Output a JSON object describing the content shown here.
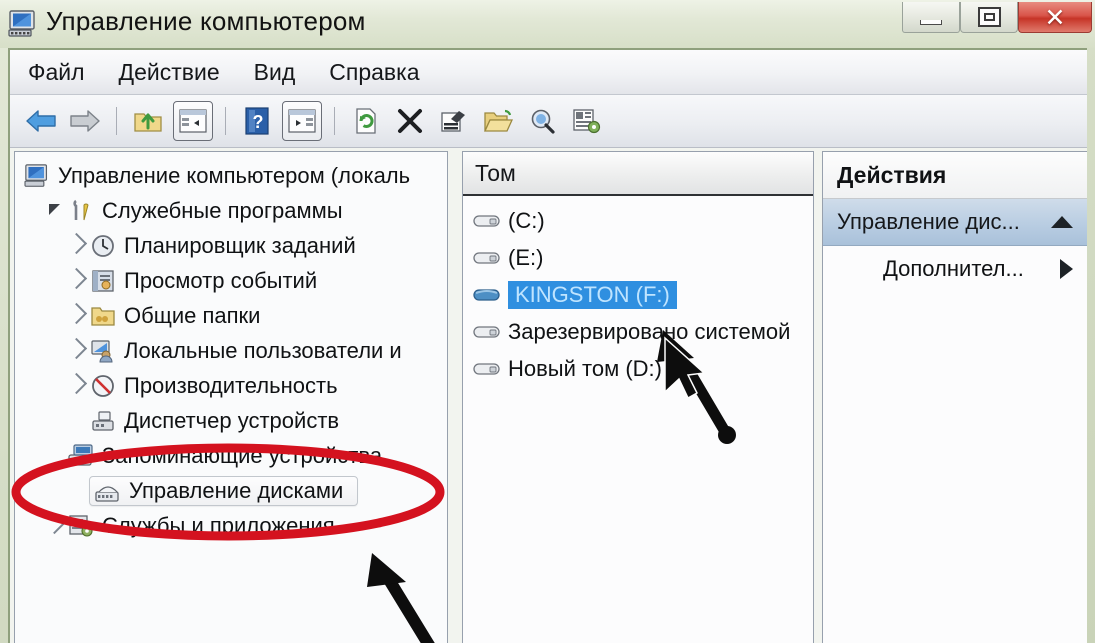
{
  "window": {
    "title": "Управление компьютером",
    "icon": "computer-icon",
    "controls": {
      "minimize": "—",
      "maximize": "❐",
      "close": "✕"
    }
  },
  "menu": {
    "items": [
      "Файл",
      "Действие",
      "Вид",
      "Справка"
    ]
  },
  "toolbar": {
    "items": [
      "back-arrow-icon",
      "forward-arrow-icon",
      "up-folder-icon",
      "show-tree-pane-icon",
      "help-icon",
      "show-action-pane-icon",
      "refresh-icon",
      "delete-icon",
      "properties-icon",
      "open-folder-icon",
      "search-icon",
      "settings-icon"
    ]
  },
  "tree": {
    "nodes": [
      {
        "label": "Управление компьютером (локаль",
        "icon": "computer-icon",
        "indent": 0,
        "twisty": "none",
        "selected": false
      },
      {
        "label": "Служебные программы",
        "icon": "tools-icon",
        "indent": 1,
        "twisty": "expanded",
        "selected": false
      },
      {
        "label": "Планировщик заданий",
        "icon": "clock-icon",
        "indent": 2,
        "twisty": "collapsed",
        "selected": false
      },
      {
        "label": "Просмотр событий",
        "icon": "event-log-icon",
        "indent": 2,
        "twisty": "collapsed",
        "selected": false
      },
      {
        "label": "Общие папки",
        "icon": "shared-folder-icon",
        "indent": 2,
        "twisty": "collapsed",
        "selected": false
      },
      {
        "label": "Локальные пользователи и",
        "icon": "users-icon",
        "indent": 2,
        "twisty": "collapsed",
        "selected": false
      },
      {
        "label": "Производительность",
        "icon": "performance-icon",
        "indent": 2,
        "twisty": "collapsed",
        "selected": false
      },
      {
        "label": "Диспетчер устройств",
        "icon": "device-manager-icon",
        "indent": 2,
        "twisty": "none",
        "selected": false
      },
      {
        "label": "Запоминающие устройства",
        "icon": "storage-icon",
        "indent": 1,
        "twisty": "expanded-hidden",
        "selected": false
      },
      {
        "label": "Управление дисками",
        "icon": "disk-management-icon",
        "indent": 2,
        "twisty": "none",
        "selected": true
      },
      {
        "label": "Службы и приложения",
        "icon": "services-icon",
        "indent": 1,
        "twisty": "collapsed",
        "selected": false
      }
    ]
  },
  "volumes": {
    "column_header": "Том",
    "rows": [
      {
        "label": "(C:)",
        "icon": "drive-icon",
        "selected": false
      },
      {
        "label": "(E:)",
        "icon": "drive-icon",
        "selected": false
      },
      {
        "label": "KINGSTON (F:)",
        "icon": "removable-drive-icon",
        "selected": true
      },
      {
        "label": "Зарезервировано системой",
        "icon": "drive-icon",
        "selected": false
      },
      {
        "label": "Новый том (D:)",
        "icon": "drive-icon",
        "selected": false
      }
    ]
  },
  "actions": {
    "header": "Действия",
    "primary": "Управление дис...",
    "primary_chevron": "chevron-up-icon",
    "secondary": "Дополнител...",
    "secondary_arrow": "chevron-right-icon"
  },
  "annotations": {
    "ellipse_color": "#d4121f",
    "arrow_color": "#0d0d0d",
    "arrows": [
      "arrow-to-volume-list",
      "arrow-to-disk-management"
    ]
  }
}
